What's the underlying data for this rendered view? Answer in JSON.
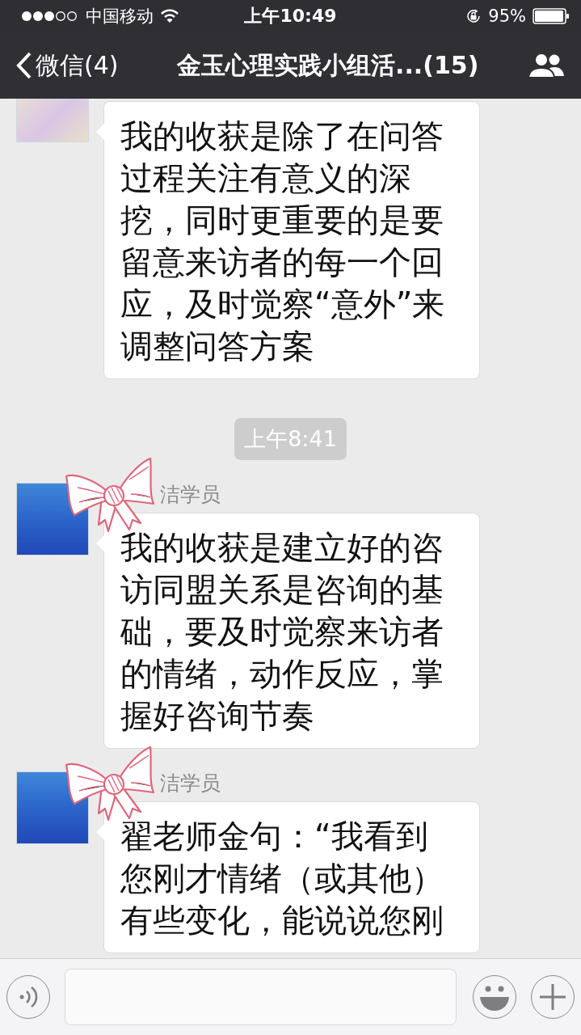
{
  "status_bar": {
    "carrier": "中国移动",
    "time": "上午10:49",
    "battery": "95%"
  },
  "nav_bar": {
    "back": "微信(4)",
    "title": "金玉心理实践小组活...(15)"
  },
  "messages": [
    {
      "kind": "message",
      "sticker": false,
      "lines": [
        "我的收获是除了在问答",
        "过程关注有意义的深",
        "挖，同时更重要的是要",
        "留意来访者的每一个回",
        "应，及时觉察“意外”来",
        "调整问答方案"
      ]
    },
    {
      "kind": "time",
      "text": "上午8:41"
    },
    {
      "kind": "message",
      "sender": "洁学员",
      "sticker": true,
      "lines": [
        "我的收获是建立好的咨",
        "访同盟关系是咨询的基",
        "础，要及时觉察来访者",
        "的情绪，动作反应，掌",
        "握好咨询节奏"
      ]
    },
    {
      "kind": "message",
      "sender": "洁学员",
      "sticker": true,
      "lines": [
        "翟老师金句：“我看到",
        "您刚才情绪（或其他）",
        "有些变化，能说说您刚"
      ]
    }
  ]
}
